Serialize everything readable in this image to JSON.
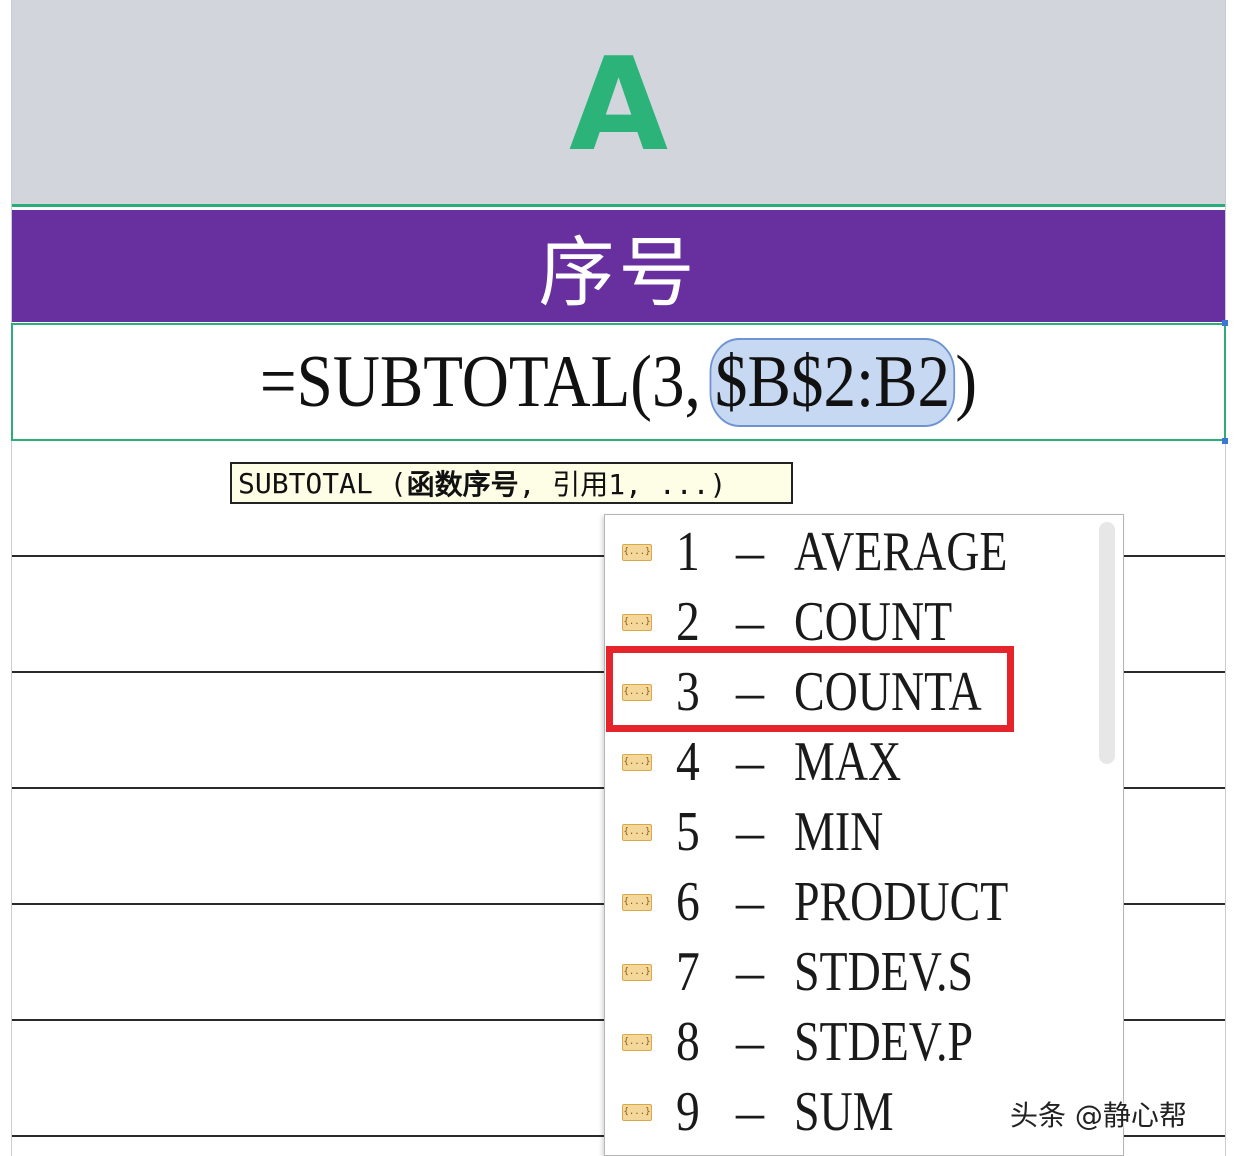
{
  "column_header": {
    "letter": "A"
  },
  "header_cell": {
    "text": "序号"
  },
  "formula": {
    "prefix": "=SUBTOTAL(3, ",
    "reference": "$B$2:B2",
    "suffix": ")"
  },
  "tooltip": {
    "func": "SUBTOTAL (",
    "arg1": "函数序号",
    "rest": ", 引用1, ...)"
  },
  "dropdown": {
    "icon_text": "{...}",
    "dash": "–",
    "items": [
      {
        "num": "1",
        "name": "AVERAGE"
      },
      {
        "num": "2",
        "name": "COUNT"
      },
      {
        "num": "3",
        "name": "COUNTA"
      },
      {
        "num": "4",
        "name": "MAX"
      },
      {
        "num": "5",
        "name": "MIN"
      },
      {
        "num": "6",
        "name": "PRODUCT"
      },
      {
        "num": "7",
        "name": "STDEV.S"
      },
      {
        "num": "8",
        "name": "STDEV.P"
      },
      {
        "num": "9",
        "name": "SUM"
      }
    ],
    "highlighted_index": 2
  },
  "watermark": {
    "text": "头条 @静心帮"
  },
  "colors": {
    "header_green": "#2cb37a",
    "header_purple": "#68309e",
    "highlight_red": "#e5252b",
    "reference_blue": "#c7d8f2"
  }
}
